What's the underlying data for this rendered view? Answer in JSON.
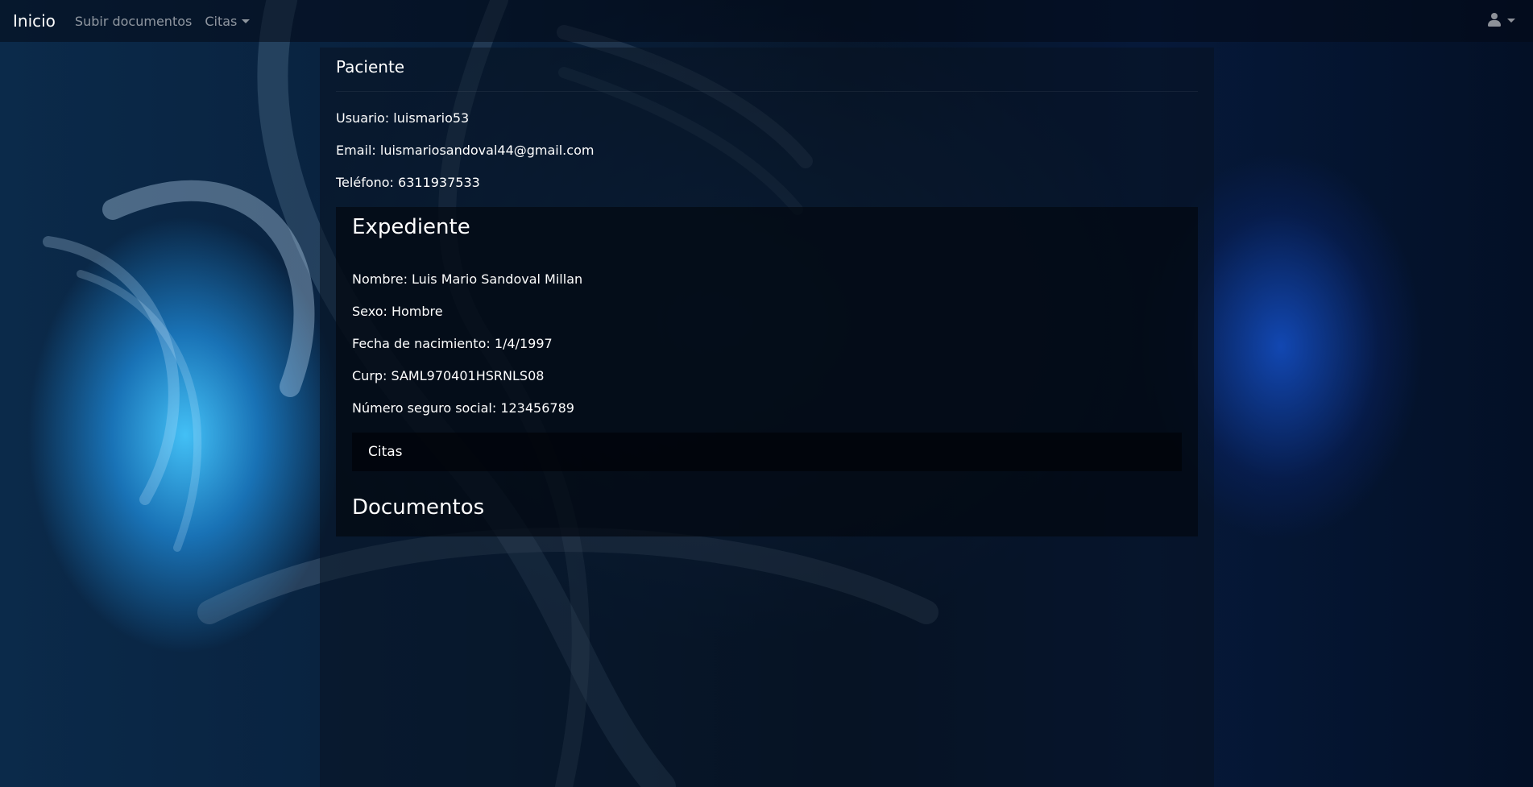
{
  "navbar": {
    "brand": "Inicio",
    "links": {
      "upload": "Subir documentos",
      "appointments": "Citas"
    }
  },
  "patient": {
    "title": "Paciente",
    "username": "Usuario: luismario53",
    "email": "Email: luismariosandoval44@gmail.com",
    "phone": "Teléfono: 6311937533"
  },
  "record": {
    "title": "Expediente",
    "name": "Nombre: Luis Mario Sandoval Millan",
    "sex": "Sexo: Hombre",
    "birthdate": "Fecha de nacimiento: 1/4/1997",
    "curp": "Curp: SAML970401HSRNLS08",
    "social_security": "Número seguro social: 123456789",
    "appointments_label": "Citas",
    "documents_title": "Documentos"
  },
  "icons": {
    "user": "user-icon",
    "dropdown": "chevron-down-icon"
  }
}
